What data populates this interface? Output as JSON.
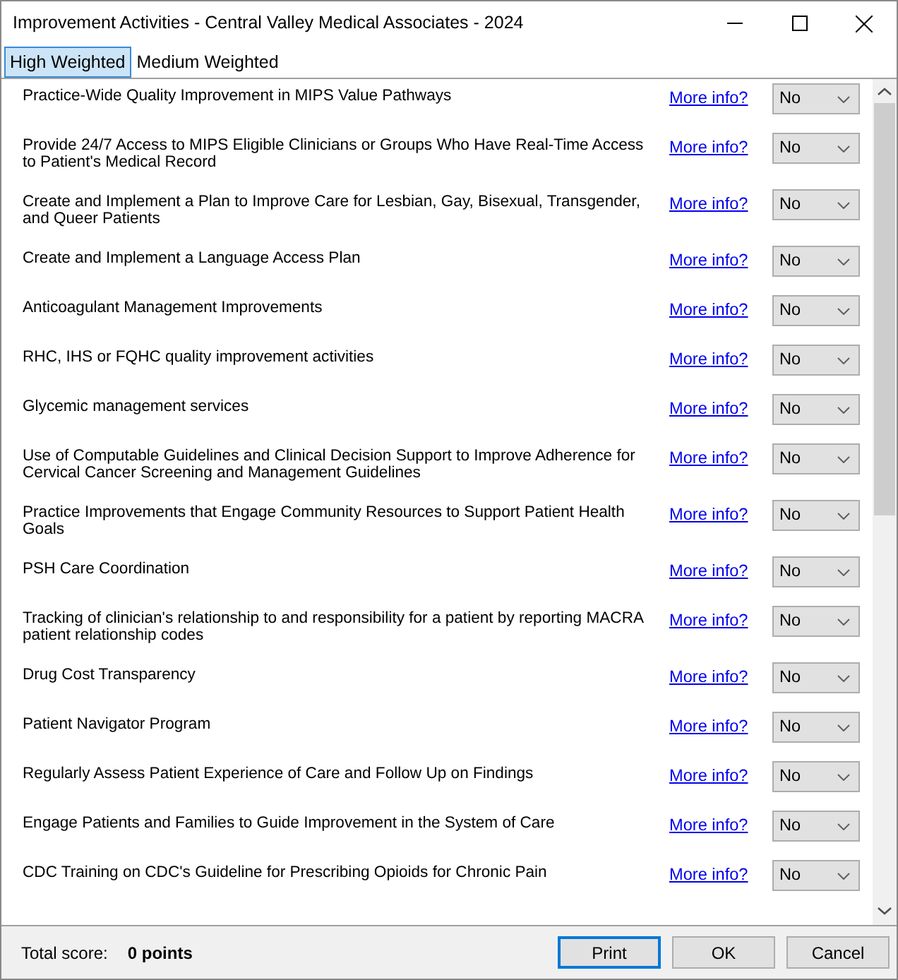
{
  "window": {
    "title": "Improvement Activities - Central Valley Medical Associates - 2024"
  },
  "tabs": [
    {
      "label": "High Weighted",
      "selected": true
    },
    {
      "label": "Medium Weighted",
      "selected": false
    }
  ],
  "activities": [
    {
      "name": "Practice-Wide Quality Improvement in MIPS Value Pathways",
      "link": "More info?",
      "value": "No"
    },
    {
      "name": "Provide 24/7 Access to MIPS Eligible Clinicians or Groups Who Have Real-Time Access to Patient's Medical Record",
      "link": "More info?",
      "value": "No"
    },
    {
      "name": "Create and Implement a Plan to Improve Care for Lesbian, Gay, Bisexual, Transgender, and Queer Patients",
      "link": "More info?",
      "value": "No"
    },
    {
      "name": "Create and Implement a Language Access Plan",
      "link": "More info?",
      "value": "No"
    },
    {
      "name": "Anticoagulant Management Improvements",
      "link": "More info?",
      "value": "No"
    },
    {
      "name": "RHC, IHS or FQHC quality improvement activities",
      "link": "More info?",
      "value": "No"
    },
    {
      "name": "Glycemic management services",
      "link": "More info?",
      "value": "No"
    },
    {
      "name": "Use of Computable Guidelines and Clinical Decision Support to Improve Adherence for Cervical Cancer Screening and Management Guidelines",
      "link": "More info?",
      "value": "No"
    },
    {
      "name": "Practice Improvements that Engage Community Resources to Support Patient Health Goals",
      "link": "More info?",
      "value": "No"
    },
    {
      "name": "PSH Care Coordination",
      "link": "More info?",
      "value": "No"
    },
    {
      "name": "Tracking of clinician's relationship to and responsibility for a patient by reporting MACRA patient relationship codes",
      "link": "More info?",
      "value": "No"
    },
    {
      "name": "Drug Cost Transparency",
      "link": "More info?",
      "value": "No"
    },
    {
      "name": "Patient Navigator Program",
      "link": "More info?",
      "value": "No"
    },
    {
      "name": "Regularly Assess Patient Experience of Care and Follow Up on Findings",
      "link": "More info?",
      "value": "No"
    },
    {
      "name": "Engage Patients and Families to Guide Improvement in the System of Care",
      "link": "More info?",
      "value": "No"
    },
    {
      "name": "CDC Training on CDC's Guideline for Prescribing Opioids for Chronic Pain",
      "link": "More info?",
      "value": "No"
    }
  ],
  "footer": {
    "label": "Total score:",
    "score": "0 points"
  },
  "buttons": [
    {
      "label": "Print",
      "default": true
    },
    {
      "label": "OK",
      "default": false
    },
    {
      "label": "Cancel",
      "default": false
    }
  ]
}
